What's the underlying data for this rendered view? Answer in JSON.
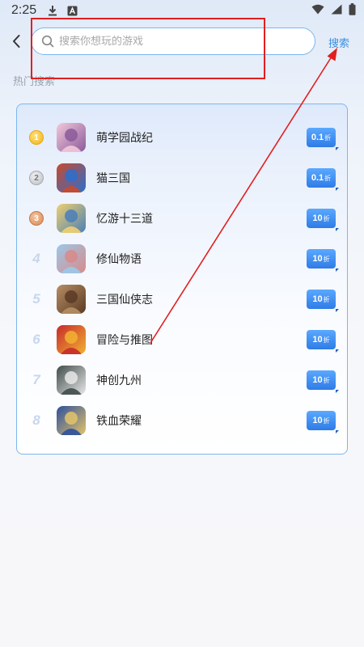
{
  "status_bar": {
    "time": "2:25",
    "icons": [
      "download-icon",
      "app-a-icon"
    ],
    "right_icons": [
      "wifi-icon",
      "signal-icon",
      "battery-icon"
    ]
  },
  "header": {
    "back_icon": "chevron-left-icon",
    "search_placeholder": "搜索你想玩的游戏",
    "search_value": "",
    "search_button": "搜索"
  },
  "hot_section": {
    "title": "热门搜索",
    "items": [
      {
        "rank": "1",
        "medal": "gold",
        "name": "萌学园战纪",
        "discount": "0.1",
        "suffix": "折",
        "icon_bg": "#f3c8da",
        "icon_fg": "#8a5a9a"
      },
      {
        "rank": "2",
        "medal": "silver",
        "name": "猫三国",
        "discount": "0.1",
        "suffix": "折",
        "icon_bg": "#c94a2d",
        "icon_fg": "#2b6fcf"
      },
      {
        "rank": "3",
        "medal": "bronze",
        "name": "忆游十三道",
        "discount": "10",
        "suffix": "折",
        "icon_bg": "#f0d070",
        "icon_fg": "#4a7fb8"
      },
      {
        "rank": "4",
        "medal": "",
        "name": "修仙物语",
        "discount": "10",
        "suffix": "折",
        "icon_bg": "#9cc8e8",
        "icon_fg": "#d88a8a"
      },
      {
        "rank": "5",
        "medal": "",
        "name": "三国仙侠志",
        "discount": "10",
        "suffix": "折",
        "icon_bg": "#b78e64",
        "icon_fg": "#5a3a24"
      },
      {
        "rank": "6",
        "medal": "",
        "name": "冒险与推图",
        "discount": "10",
        "suffix": "折",
        "icon_bg": "#c72a2a",
        "icon_fg": "#f2b233"
      },
      {
        "rank": "7",
        "medal": "",
        "name": "神创九州",
        "discount": "10",
        "suffix": "折",
        "icon_bg": "#3f4c4a",
        "icon_fg": "#e8e8e8"
      },
      {
        "rank": "8",
        "medal": "",
        "name": "铁血荣耀",
        "discount": "10",
        "suffix": "折",
        "icon_bg": "#2d4f9c",
        "icon_fg": "#e3c46a"
      }
    ]
  },
  "colors": {
    "accent": "#3b8fe0",
    "annotation": "#e02020"
  }
}
